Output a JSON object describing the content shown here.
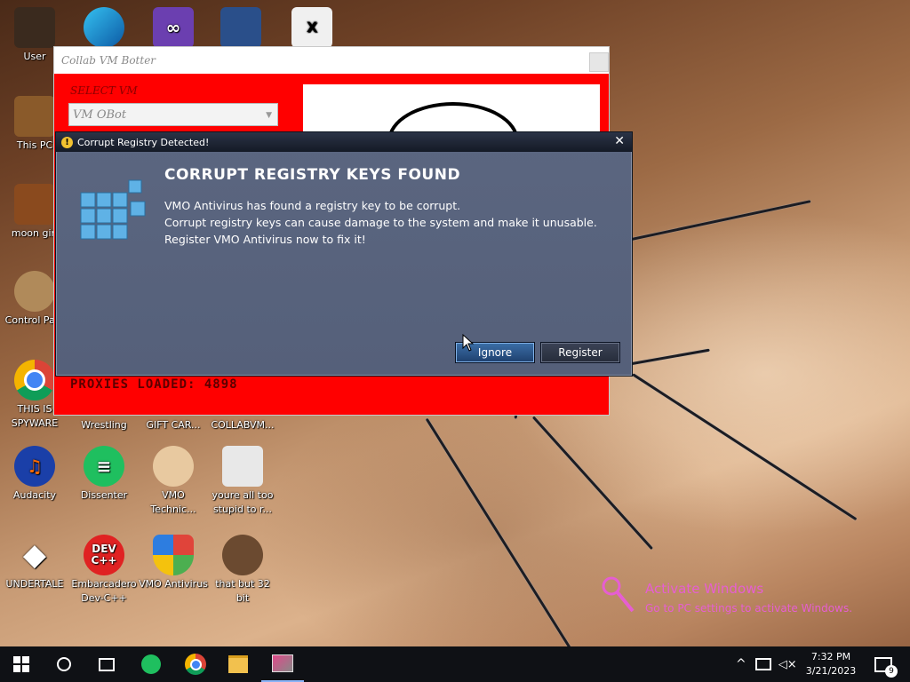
{
  "desktop": {
    "icons": [
      {
        "label": "User"
      },
      {
        "label": "This PC"
      },
      {
        "label": "moon girl"
      },
      {
        "label": "Control Pa..."
      },
      {
        "label": "THIS IS SPYWARE"
      },
      {
        "label": "Wrestling"
      },
      {
        "label": "GIFT CAR..."
      },
      {
        "label": "COLLABVM..."
      },
      {
        "label": "Audacity"
      },
      {
        "label": "Dissenter"
      },
      {
        "label": "VMO Technic..."
      },
      {
        "label": "youre all too stupid to r..."
      },
      {
        "label": "UNDERTALE"
      },
      {
        "label": "Embarcadero Dev-C++"
      },
      {
        "label": "VMO Antivirus"
      },
      {
        "label": "that but 32 bit"
      }
    ],
    "dev_icon_text": [
      "DEV",
      "C++"
    ]
  },
  "collab_window": {
    "title": "Collab VM Botter",
    "select_label": "SELECT VM",
    "selected_vm": "VM OBot",
    "proxies_label": "PROXIES LOADED: 4898"
  },
  "dialog": {
    "title": "Corrupt Registry Detected!",
    "close_glyph": "✕",
    "heading": "CORRUPT REGISTRY KEYS FOUND",
    "lines": [
      "VMO Antivirus has found a registry key to be corrupt.",
      "Corrupt registry keys can cause damage to the system and make it unusable.",
      "Register VMO Antivirus now to fix it!"
    ],
    "ignore_label": "Ignore",
    "register_label": "Register"
  },
  "watermark": {
    "title": "Activate Windows",
    "subtitle": "Go to PC settings to activate Windows."
  },
  "taskbar": {
    "time": "7:32 PM",
    "date": "3/21/2023",
    "notification_count": "9"
  },
  "colors": {
    "collab_bg": "#ff0000",
    "dialog_bg": "#5b6680",
    "watermark": "#e65ed2"
  }
}
